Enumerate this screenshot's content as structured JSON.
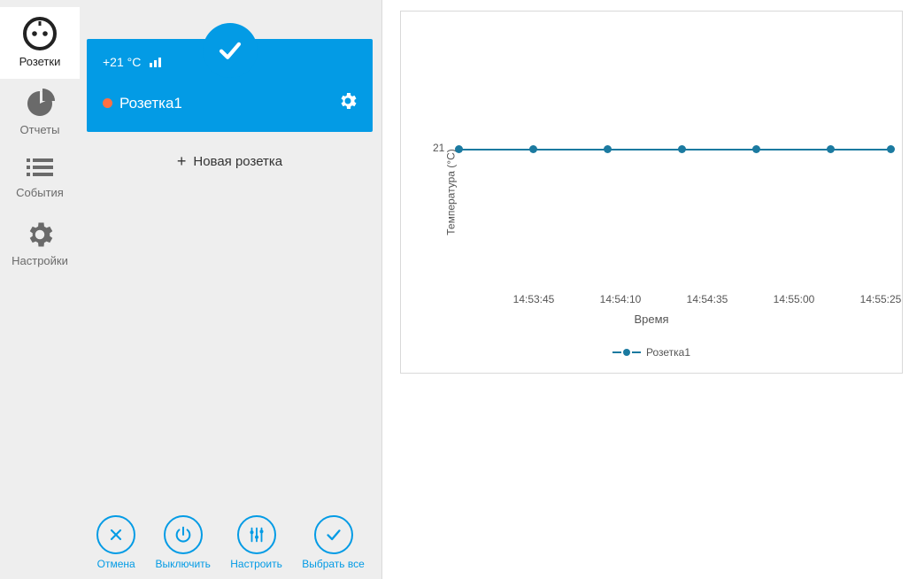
{
  "sidebar": {
    "items": [
      {
        "label": "Розетки",
        "icon": "socket-icon"
      },
      {
        "label": "Отчеты",
        "icon": "pie-chart-icon"
      },
      {
        "label": "События",
        "icon": "list-icon"
      },
      {
        "label": "Настройки",
        "icon": "gear-icon"
      }
    ]
  },
  "socket_card": {
    "temperature": "+21 °C",
    "name": "Розетка1",
    "status_color": "#ff7043"
  },
  "add_socket_label": "Новая розетка",
  "actions": {
    "cancel": "Отмена",
    "turn_off": "Выключить",
    "configure": "Настроить",
    "select_all": "Выбрать все"
  },
  "chart_data": {
    "type": "line",
    "title": "",
    "ylabel": "Температура (°C)",
    "xlabel": "Время",
    "ylim": [
      20,
      22
    ],
    "y_ticks": [
      21
    ],
    "x_ticks": [
      "14:53:45",
      "14:54:10",
      "14:54:35",
      "14:55:00",
      "14:55:25"
    ],
    "series": [
      {
        "name": "Розетка1",
        "x": [
          "14:53:20",
          "14:53:45",
          "14:54:10",
          "14:54:35",
          "14:55:00",
          "14:55:25"
        ],
        "y": [
          21,
          21,
          21,
          21,
          21,
          21
        ]
      }
    ]
  }
}
